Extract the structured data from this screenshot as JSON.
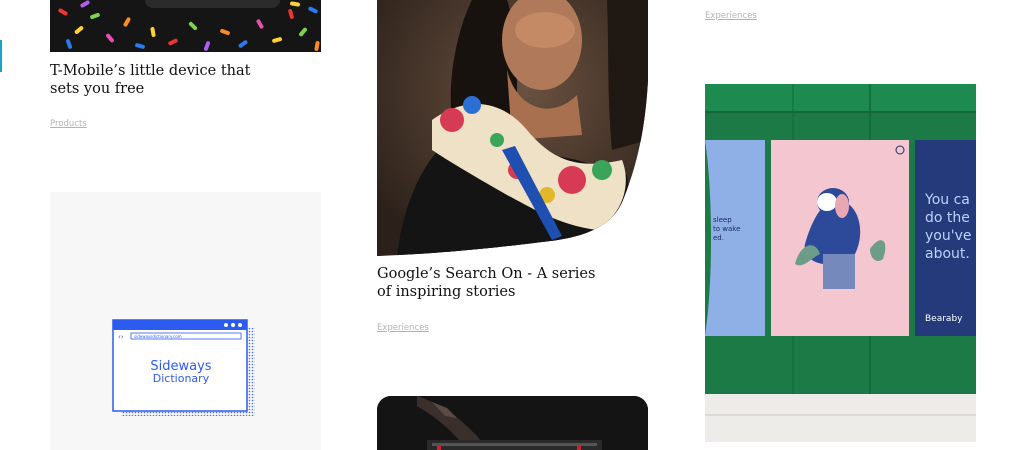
{
  "cards": [
    {
      "title_line1": "T-Mobile’s little device that",
      "title_line2": "sets you free",
      "category": "Products",
      "image_icon": "t-mobile-device-image"
    },
    {
      "title_line1": "Google’s Search On - A series",
      "title_line2": "of inspiring stories",
      "category": "Experiences",
      "image_icon": "portrait-woman-scarf-image"
    },
    {
      "category": "Experiences"
    },
    {
      "image_icon": "sideways-dictionary-image",
      "browser_url": "sidewaysdictionary.com",
      "logo_line1": "Sideways",
      "logo_line2": "Dictionary"
    },
    {
      "image_icon": "bearaby-posters-image",
      "poster_left_text": [
        "sleep",
        "to wake",
        "ed."
      ],
      "poster_right_text": [
        "You ca",
        "do the",
        "you've",
        "about."
      ],
      "poster_brand": "Bearaby"
    },
    {
      "image_icon": "music-gear-image"
    }
  ],
  "colors": {
    "link_grey": "#b2b2b2",
    "sideways_blue": "#2c5bf0",
    "green_wall": "#1b7a45",
    "poster_pink": "#f4c7d0",
    "poster_navy": "#243a7a"
  }
}
